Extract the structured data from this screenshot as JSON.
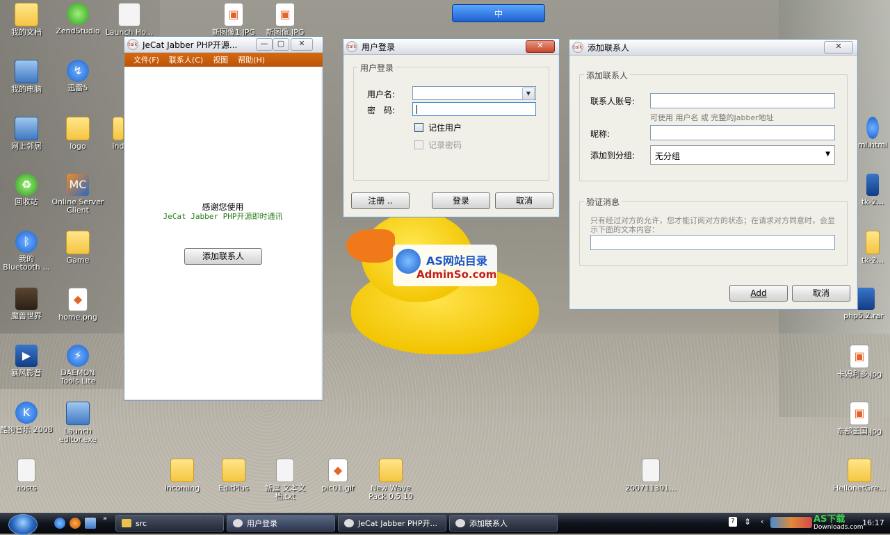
{
  "desktop": {
    "icons_left": [
      {
        "label": "我的文档",
        "glyph": "folder-doc"
      },
      {
        "label": "我的电脑",
        "glyph": "computer"
      },
      {
        "label": "网上邻居",
        "glyph": "network"
      },
      {
        "label": "回收站",
        "glyph": "recycle"
      },
      {
        "label": "我的 Bluetooth ...",
        "glyph": "bluetooth"
      },
      {
        "label": "魔兽世界",
        "glyph": "game"
      },
      {
        "label": "暴风影音",
        "glyph": "player"
      },
      {
        "label": "酷狗音乐 2008",
        "glyph": "kugou"
      },
      {
        "label": "hosts",
        "glyph": "file"
      }
    ],
    "icons_col2": [
      {
        "label": "ZendStudio"
      },
      {
        "label": "迅雷5"
      },
      {
        "label": "logo"
      },
      {
        "label": "Online Server Client"
      },
      {
        "label": "Game"
      },
      {
        "label": "home.png"
      },
      {
        "label": "DAEMON Tools Lite"
      },
      {
        "label": "Launch editor.exe"
      }
    ],
    "icons_col3": [
      {
        "label": "Launch Ho..."
      },
      {
        "label": "ind"
      }
    ],
    "icons_top": [
      {
        "label": "新图像1.JPG"
      },
      {
        "label": "新图像.JPG"
      }
    ],
    "icons_bottom": [
      {
        "label": "incoming"
      },
      {
        "label": "EditPlus"
      },
      {
        "label": "新建 文本文档.txt"
      },
      {
        "label": "pic01.gif"
      },
      {
        "label": "New Wave Pack 0.5.10"
      },
      {
        "label": "200711301..."
      },
      {
        "label": "HellonetGre..."
      }
    ],
    "icons_right": [
      {
        "label": "ml.html"
      },
      {
        "label": "tk-2..."
      },
      {
        "label": "tk-2..."
      },
      {
        "label": "php5.2.rar"
      },
      {
        "label": "卡姆利多.jpg"
      },
      {
        "label": "东部王国.jpg"
      }
    ],
    "langbar": "中",
    "watermark_line1": "AS网站目录",
    "watermark_line2": "AdminSo.com"
  },
  "main_window": {
    "title": "JeCat Jabber PHP开源...",
    "menu": [
      "文件(F)",
      "联系人(C)",
      "视图",
      "帮助(H)"
    ],
    "welcome": "感谢您使用",
    "product": "JeCat Jabber PHP开源即时通讯",
    "add_contact_button": "添加联系人"
  },
  "login_window": {
    "title": "用户登录",
    "group_title": "用户登录",
    "username_label": "用户名:",
    "password_label": "密　码:",
    "username_value": "",
    "password_value": "",
    "remember_user": "记住用户",
    "remember_password": "记录密码",
    "register_button": "注册 ..",
    "login_button": "登录",
    "cancel_button": "取消",
    "close_glyph": "✕"
  },
  "add_contact_window": {
    "title": "添加联系人",
    "group_title": "添加联系人",
    "account_label": "联系人账号:",
    "account_hint": "可使用 用户名 或 完整的Jabber地址",
    "nickname_label": "昵称:",
    "group_label": "添加到分组:",
    "group_value": "无分组",
    "verify_group_title": "验证消息",
    "verify_hint": "只有经过对方的允许，您才能订阅对方的状态；在请求对方同意时，会显示下面的文本内容：",
    "add_button": "Add",
    "cancel_button": "取消"
  },
  "taskbar": {
    "items": [
      {
        "label": "src"
      },
      {
        "label": "用户登录"
      },
      {
        "label": "JeCat Jabber PHP开..."
      },
      {
        "label": "添加联系人"
      }
    ],
    "clock": "16:17",
    "tray_brand": "AS下载",
    "tray_site": "Downloads.com"
  },
  "colors": {
    "menubar": "#d9680c",
    "product_text": "#2e7d1a"
  }
}
